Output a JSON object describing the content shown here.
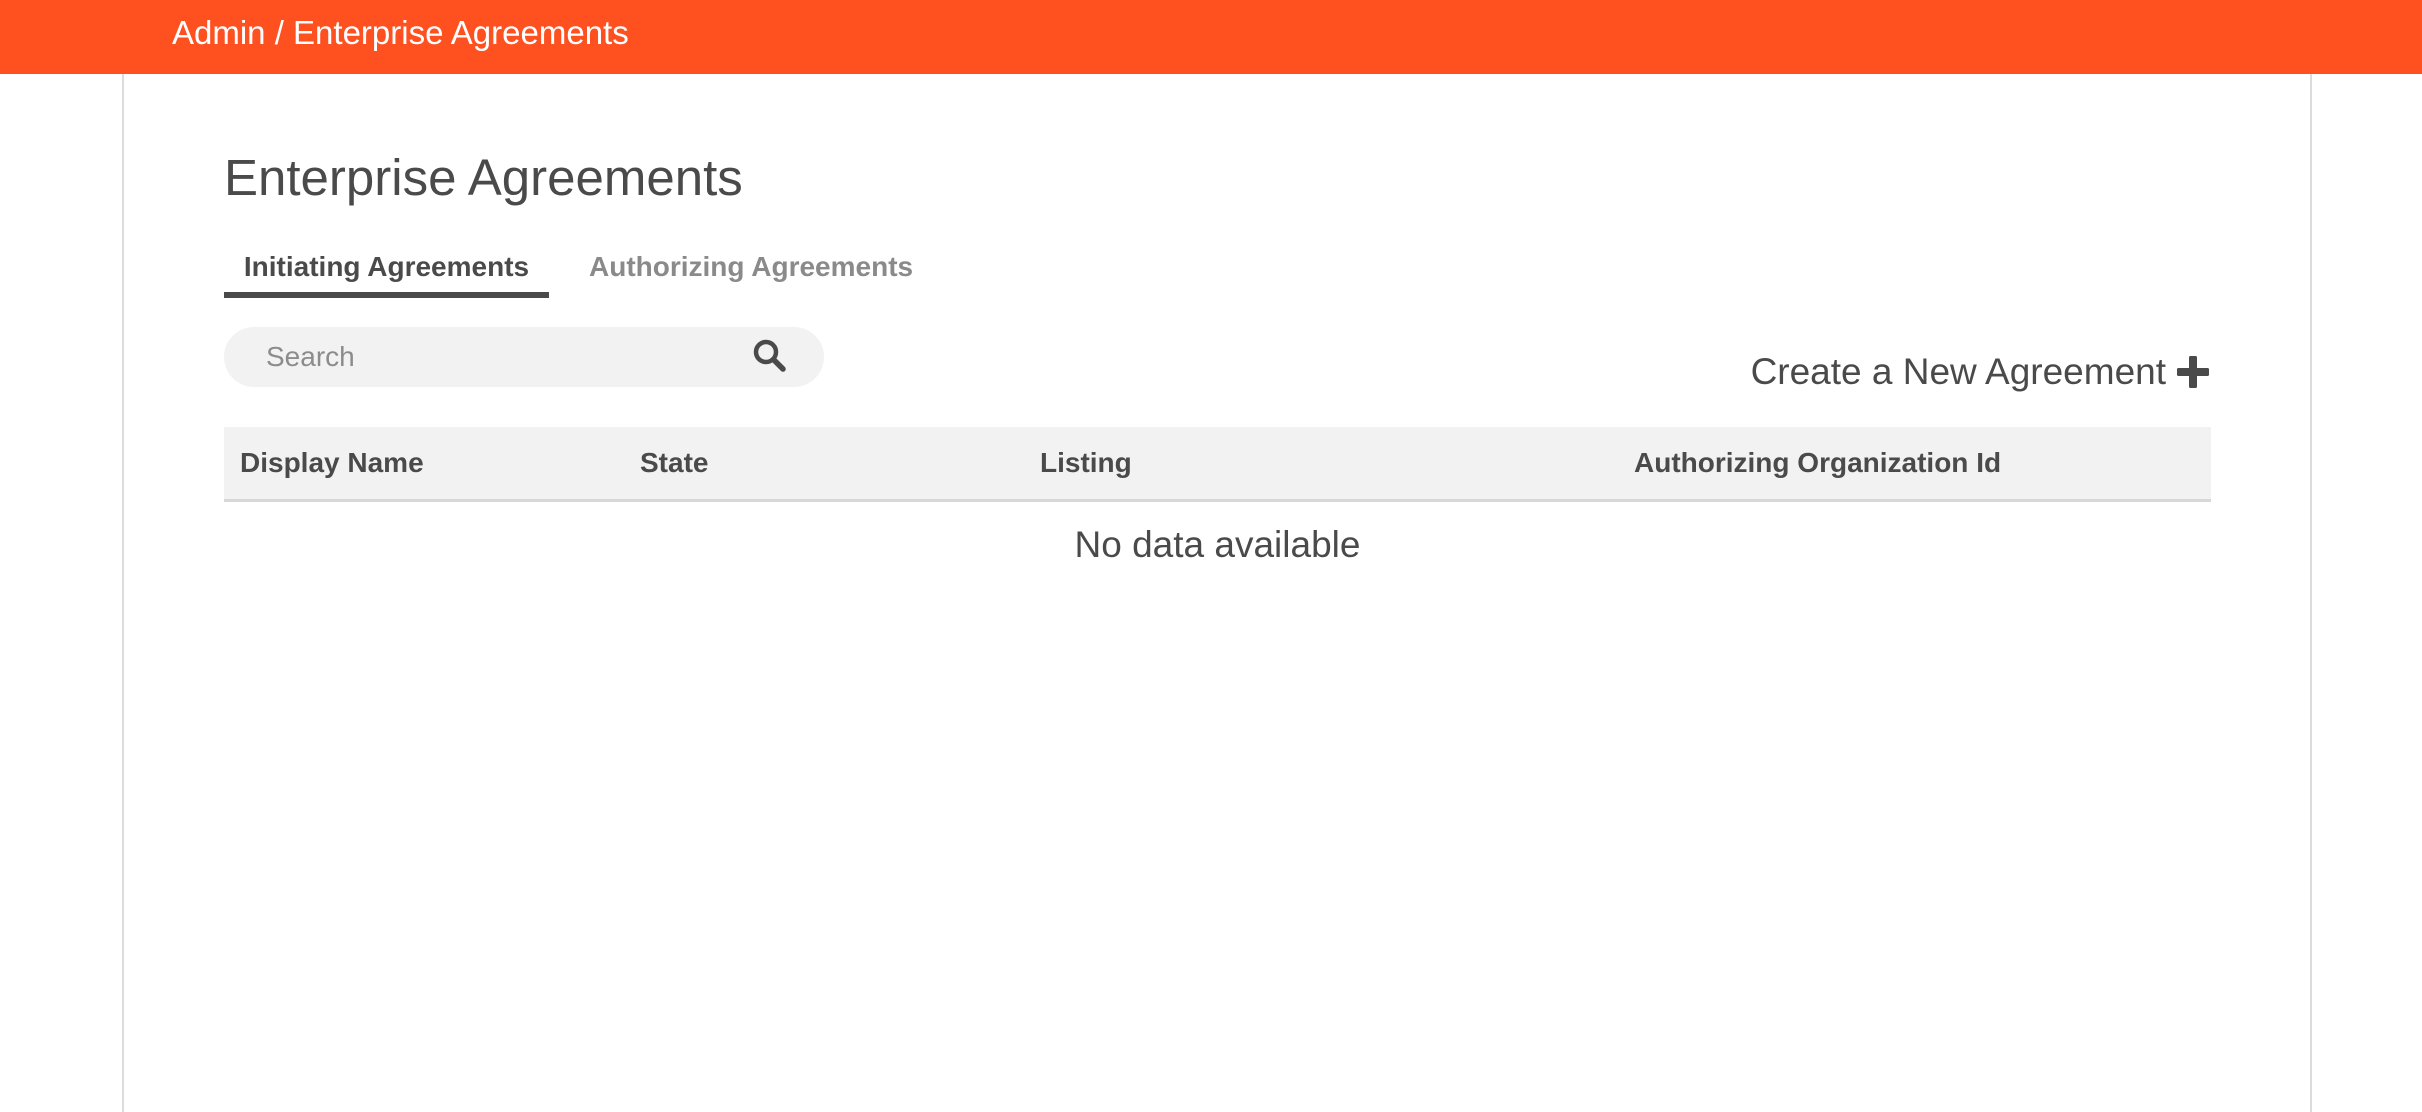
{
  "header": {
    "breadcrumb": "Admin / Enterprise Agreements"
  },
  "page": {
    "title": "Enterprise Agreements"
  },
  "tabs": [
    {
      "label": "Initiating Agreements",
      "active": true
    },
    {
      "label": "Authorizing Agreements",
      "active": false
    }
  ],
  "search": {
    "placeholder": "Search",
    "value": "",
    "icon": "search-icon"
  },
  "create": {
    "label": "Create a New Agreement",
    "icon": "plus-icon"
  },
  "table": {
    "columns": [
      "Display Name",
      "State",
      "Listing",
      "Authorizing Organization Id"
    ],
    "rows": [],
    "empty_text": "No data available"
  },
  "colors": {
    "accent": "#ff5020",
    "text": "#4a4a4a",
    "muted": "#8a8a8a",
    "header_bg": "#f2f2f2"
  }
}
